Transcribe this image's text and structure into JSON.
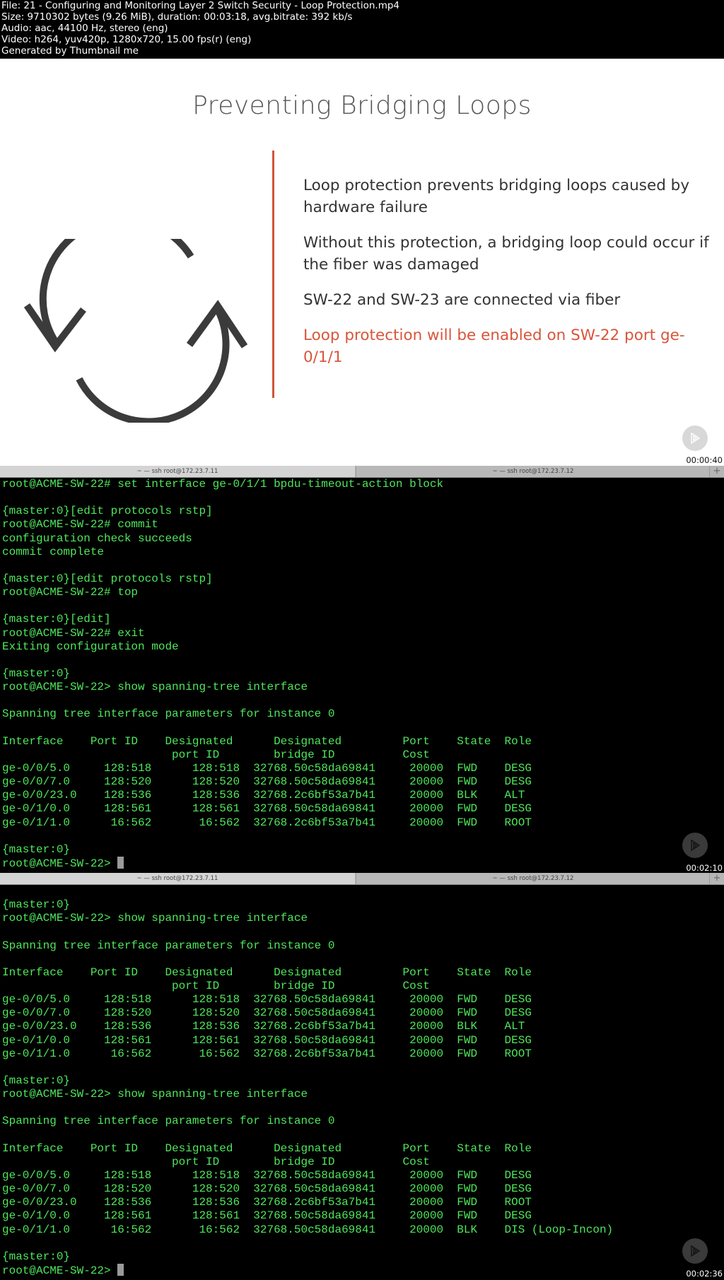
{
  "header": {
    "lines": [
      "File: 21 - Configuring and Monitoring Layer 2 Switch Security - Loop Protection.mp4",
      "Size: 9710302 bytes (9.26 MiB), duration: 00:03:18, avg.bitrate: 392 kb/s",
      "Audio: aac, 44100 Hz, stereo (eng)",
      "Video: h264, yuv420p, 1280x720, 15.00 fps(r) (eng)",
      "Generated by Thumbnail me"
    ]
  },
  "slide": {
    "title": "Preventing Bridging Loops",
    "icon": "refresh-loop-icon",
    "bullets": [
      {
        "text": "Loop protection prevents bridging loops caused by hardware failure"
      },
      {
        "text": "Without this protection, a bridging loop could occur if the fiber was damaged"
      },
      {
        "text": "SW-22 and SW-23 are connected via fiber"
      },
      {
        "text": "Loop protection will be enabled on SW-22 port ge-0/1/1"
      }
    ],
    "accent_color": "#d9553a",
    "timestamp": "00:00:40"
  },
  "terminal_tabs": {
    "tab1": "~ — ssh root@172.23.7.11",
    "tab2": "~ — ssh root@172.23.7.12",
    "add": "+"
  },
  "terminal_color": "#4ee65a",
  "frame2": {
    "timestamp": "00:02:10",
    "lines": [
      "root@ACME-SW-22# set interface ge-0/1/1 bpdu-timeout-action block",
      "",
      "{master:0}[edit protocols rstp]",
      "root@ACME-SW-22# commit",
      "configuration check succeeds",
      "commit complete",
      "",
      "{master:0}[edit protocols rstp]",
      "root@ACME-SW-22# top",
      "",
      "{master:0}[edit]",
      "root@ACME-SW-22# exit",
      "Exiting configuration mode",
      "",
      "{master:0}",
      "root@ACME-SW-22> show spanning-tree interface",
      "",
      "Spanning tree interface parameters for instance 0",
      "",
      "Interface    Port ID    Designated      Designated         Port    State  Role",
      "                         port ID        bridge ID          Cost",
      "ge-0/0/5.0     128:518      128:518  32768.50c58da69841     20000  FWD    DESG",
      "ge-0/0/7.0     128:520      128:520  32768.50c58da69841     20000  FWD    DESG",
      "ge-0/0/23.0    128:536      128:536  32768.2c6bf53a7b41     20000  BLK    ALT",
      "ge-0/1/0.0     128:561      128:561  32768.50c58da69841     20000  FWD    DESG",
      "ge-0/1/1.0      16:562       16:562  32768.2c6bf53a7b41     20000  FWD    ROOT",
      "",
      "{master:0}",
      "root@ACME-SW-22> "
    ]
  },
  "frame3": {
    "timestamp": "00:02:36",
    "lines": [
      "",
      "{master:0}",
      "root@ACME-SW-22> show spanning-tree interface",
      "",
      "Spanning tree interface parameters for instance 0",
      "",
      "Interface    Port ID    Designated      Designated         Port    State  Role",
      "                         port ID        bridge ID          Cost",
      "ge-0/0/5.0     128:518      128:518  32768.50c58da69841     20000  FWD    DESG",
      "ge-0/0/7.0     128:520      128:520  32768.50c58da69841     20000  FWD    DESG",
      "ge-0/0/23.0    128:536      128:536  32768.2c6bf53a7b41     20000  BLK    ALT",
      "ge-0/1/0.0     128:561      128:561  32768.50c58da69841     20000  FWD    DESG",
      "ge-0/1/1.0      16:562       16:562  32768.2c6bf53a7b41     20000  FWD    ROOT",
      "",
      "{master:0}",
      "root@ACME-SW-22> show spanning-tree interface",
      "",
      "Spanning tree interface parameters for instance 0",
      "",
      "Interface    Port ID    Designated      Designated         Port    State  Role",
      "                         port ID        bridge ID          Cost",
      "ge-0/0/5.0     128:518      128:518  32768.50c58da69841     20000  FWD    DESG",
      "ge-0/0/7.0     128:520      128:520  32768.50c58da69841     20000  FWD    DESG",
      "ge-0/0/23.0    128:536      128:536  32768.2c6bf53a7b41     20000  FWD    ROOT",
      "ge-0/1/0.0     128:561      128:561  32768.50c58da69841     20000  FWD    DESG",
      "ge-0/1/1.0      16:562       16:562  32768.50c58da69841     20000  BLK    DIS (Loop-Incon)",
      "",
      "{master:0}",
      "root@ACME-SW-22> "
    ]
  }
}
